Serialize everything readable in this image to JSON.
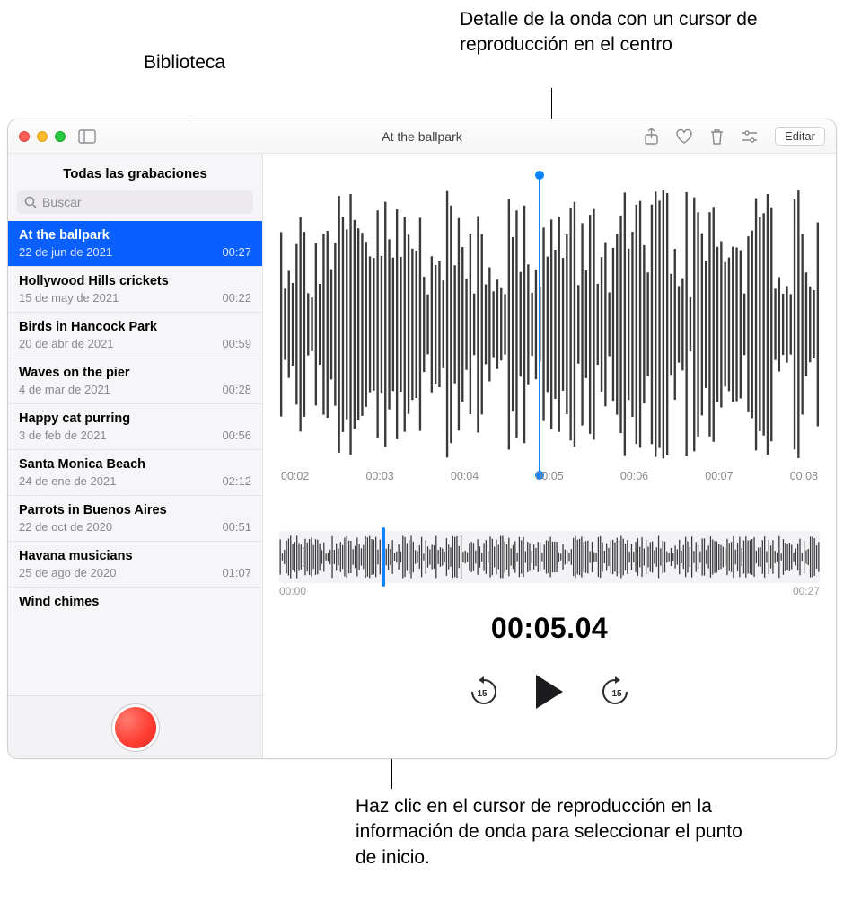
{
  "callouts": {
    "top_left": "Biblioteca",
    "top_right": "Detalle de la onda con un cursor de reproducción en el centro",
    "bottom": "Haz clic en el cursor de reproducción en la información de onda para seleccionar el punto de inicio."
  },
  "window": {
    "title": "At the ballpark",
    "edit_label": "Editar"
  },
  "icons": {
    "sidebar_toggle": "sidebar-toggle-icon",
    "share": "share-icon",
    "favorite": "heart-icon",
    "delete": "trash-icon",
    "settings": "sliders-icon"
  },
  "sidebar": {
    "title": "Todas las grabaciones",
    "search_placeholder": "Buscar",
    "items": [
      {
        "name": "At the ballpark",
        "date": "22 de jun de 2021",
        "dur": "00:27",
        "selected": true
      },
      {
        "name": "Hollywood Hills crickets",
        "date": "15 de may de 2021",
        "dur": "00:22"
      },
      {
        "name": "Birds in Hancock Park",
        "date": "20 de abr de 2021",
        "dur": "00:59"
      },
      {
        "name": "Waves on the pier",
        "date": "4 de mar de 2021",
        "dur": "00:28"
      },
      {
        "name": "Happy cat purring",
        "date": "3 de feb de 2021",
        "dur": "00:56"
      },
      {
        "name": "Santa Monica Beach",
        "date": "24 de ene de 2021",
        "dur": "02:12"
      },
      {
        "name": "Parrots in Buenos Aires",
        "date": "22 de oct de 2020",
        "dur": "00:51"
      },
      {
        "name": "Havana musicians",
        "date": "25 de ago de 2020",
        "dur": "01:07"
      },
      {
        "name": "Wind chimes",
        "date": "",
        "dur": ""
      }
    ]
  },
  "detail": {
    "ticks": [
      "00:02",
      "00:03",
      "00:04",
      "00:05",
      "00:06",
      "00:07",
      "00:08"
    ],
    "playhead_percent": 48
  },
  "overview": {
    "start": "00:00",
    "end": "00:27",
    "playhead_percent": 19
  },
  "timer": "00:05.04",
  "transport": {
    "back_seconds": "15",
    "fwd_seconds": "15"
  },
  "colors": {
    "accent": "#0a84ff",
    "record": "#ff3b30"
  }
}
